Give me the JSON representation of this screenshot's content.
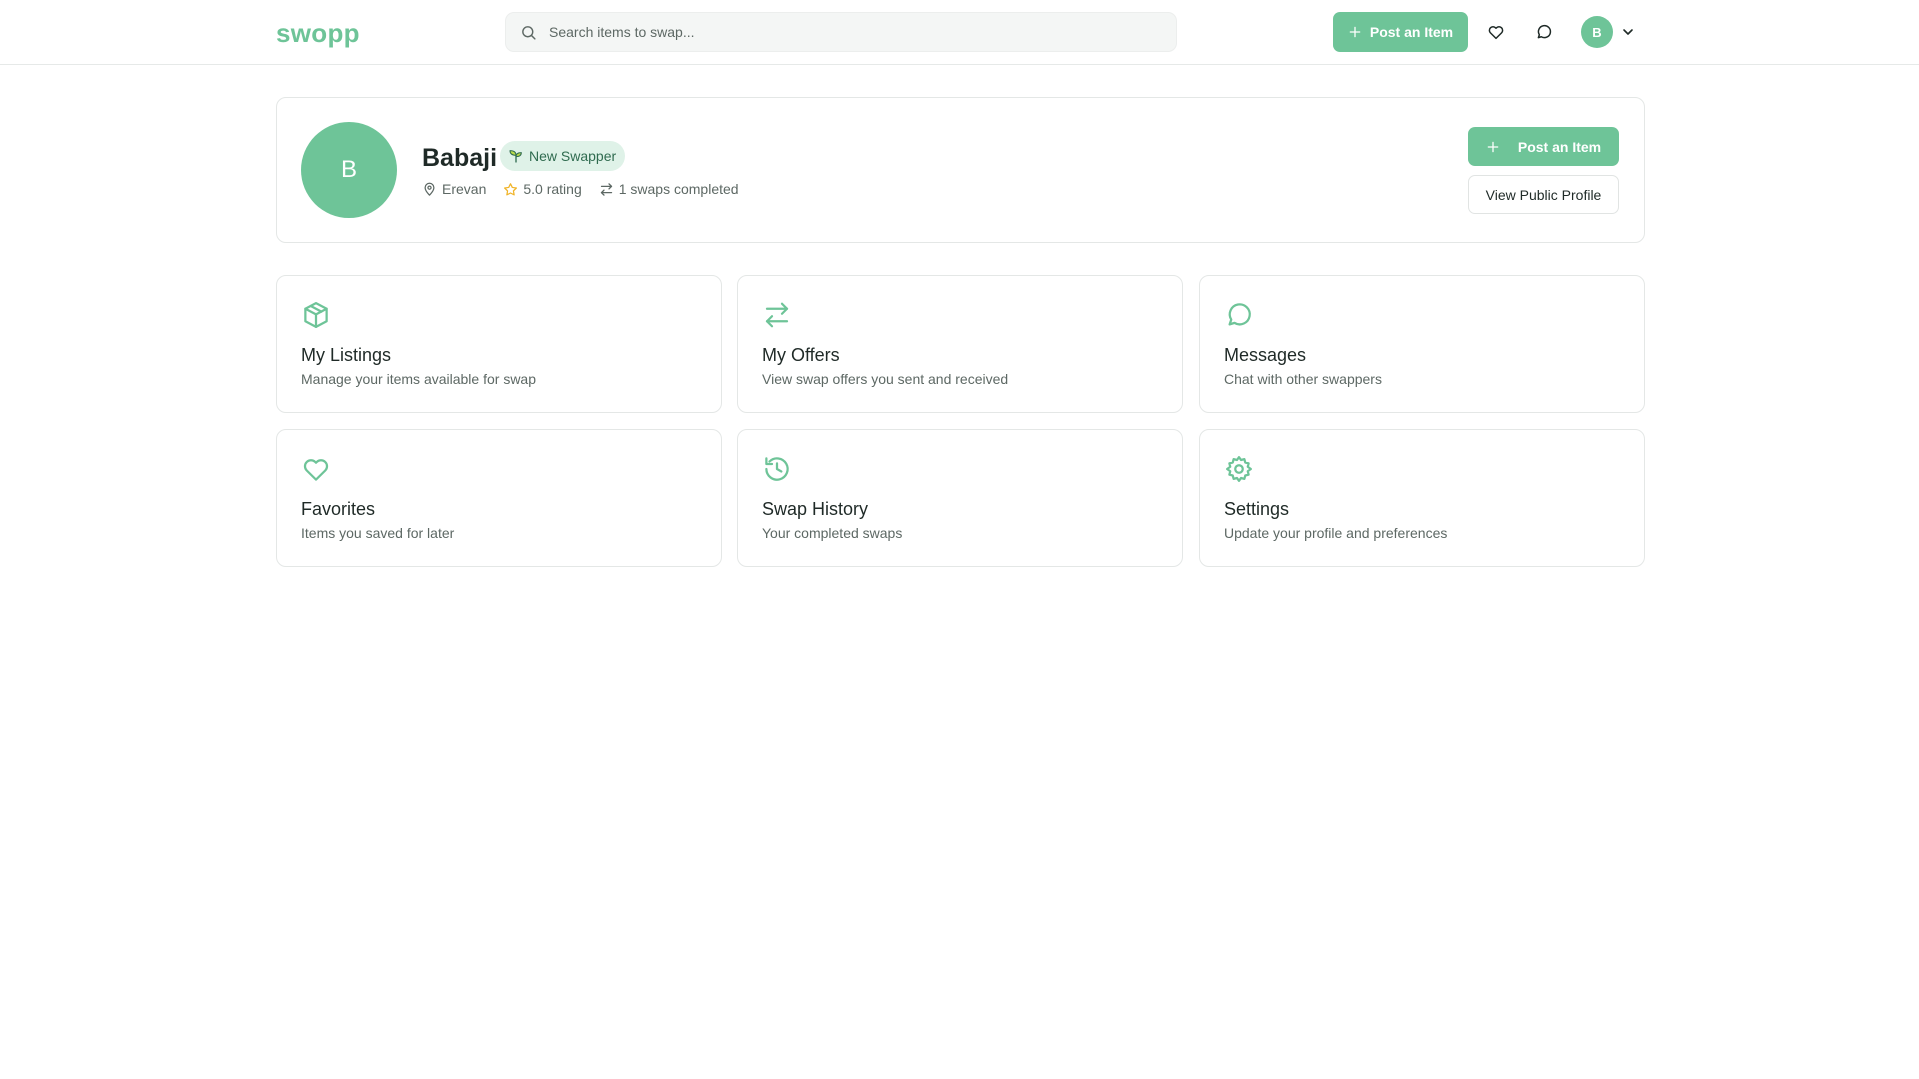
{
  "header": {
    "logo": "swopp",
    "search_placeholder": "Search items to swap...",
    "post_label": "Post an Item",
    "avatar_initial": "B",
    "icons": [
      "search-icon",
      "plus-icon",
      "heart-icon",
      "message-icon",
      "chevron-down-icon"
    ]
  },
  "profile": {
    "initial": "B",
    "name": "Babaji",
    "badge": "New Swapper",
    "location": "Erevan",
    "rating": "5.0 rating",
    "swaps": "1 swaps completed",
    "post_label": "Post an Item",
    "view_label": "View Public Profile"
  },
  "tiles": [
    {
      "title": "My Listings",
      "desc": "Manage your items available for swap",
      "icon": "package-icon"
    },
    {
      "title": "My Offers",
      "desc": "View swap offers you sent and received",
      "icon": "arrows-swap-icon"
    },
    {
      "title": "Messages",
      "desc": "Chat with other swappers",
      "icon": "message-icon"
    },
    {
      "title": "Favorites",
      "desc": "Items you saved for later",
      "icon": "heart-icon"
    },
    {
      "title": "Swap History",
      "desc": "Your completed swaps",
      "icon": "history-icon"
    },
    {
      "title": "Settings",
      "desc": "Update your profile and preferences",
      "icon": "gear-icon"
    }
  ],
  "colors": {
    "accent": "#6ec498",
    "badge_bg": "#dff2e8",
    "star": "#f0b429",
    "text": "#1f2a27",
    "muted": "#5d6864"
  }
}
